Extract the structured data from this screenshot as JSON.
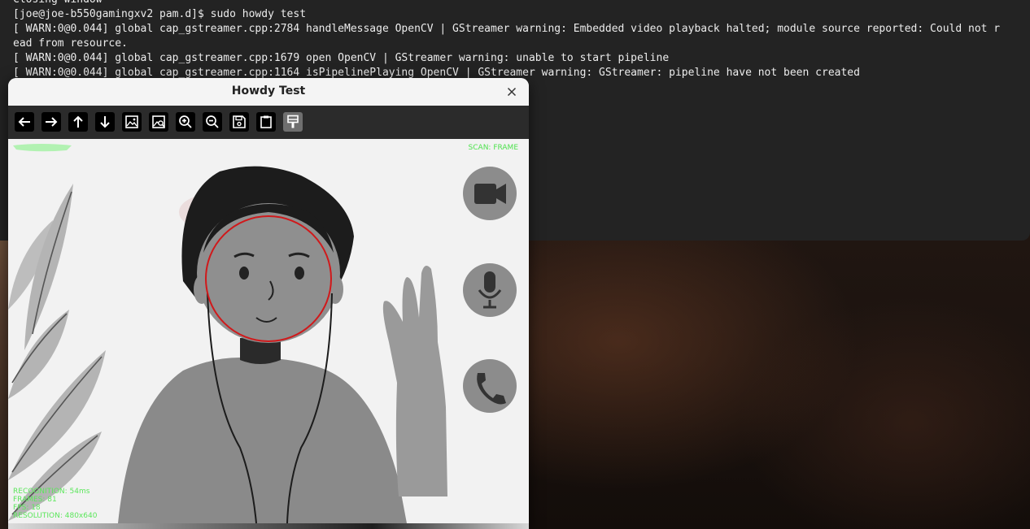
{
  "terminal": {
    "lines": [
      "Closing window",
      "[joe@joe-b550gamingxv2 pam.d]$ sudo howdy test",
      "[ WARN:0@0.044] global cap_gstreamer.cpp:2784 handleMessage OpenCV | GStreamer warning: Embedded video playback halted; module source reported: Could not r",
      "ead from resource.",
      "[ WARN:0@0.044] global cap_gstreamer.cpp:1679 open OpenCV | GStreamer warning: unable to start pipeline",
      "[ WARN:0@0.044] global cap_gstreamer.cpp:1164 isPipelinePlaying OpenCV | GStreamer warning: GStreamer: pipeline have not been created"
    ]
  },
  "window": {
    "title": "Howdy Test",
    "toolbar": [
      {
        "icon": "arrow-left-icon"
      },
      {
        "icon": "arrow-right-icon"
      },
      {
        "icon": "arrow-up-icon"
      },
      {
        "icon": "arrow-down-icon"
      },
      {
        "icon": "image-icon"
      },
      {
        "icon": "image-search-icon"
      },
      {
        "icon": "zoom-in-icon"
      },
      {
        "icon": "zoom-out-icon"
      },
      {
        "icon": "save-icon"
      },
      {
        "icon": "clipboard-icon"
      },
      {
        "icon": "paint-brush-icon"
      }
    ],
    "scan_label": "SCAN: FRAME",
    "stats": [
      "RECOGNITION: 54ms",
      "FRAMES: 81",
      "FPS: 18",
      "RESOLUTION: 480x640"
    ],
    "face_circle_color": "#d0191b",
    "overlay_text_color": "#4ee24e"
  }
}
